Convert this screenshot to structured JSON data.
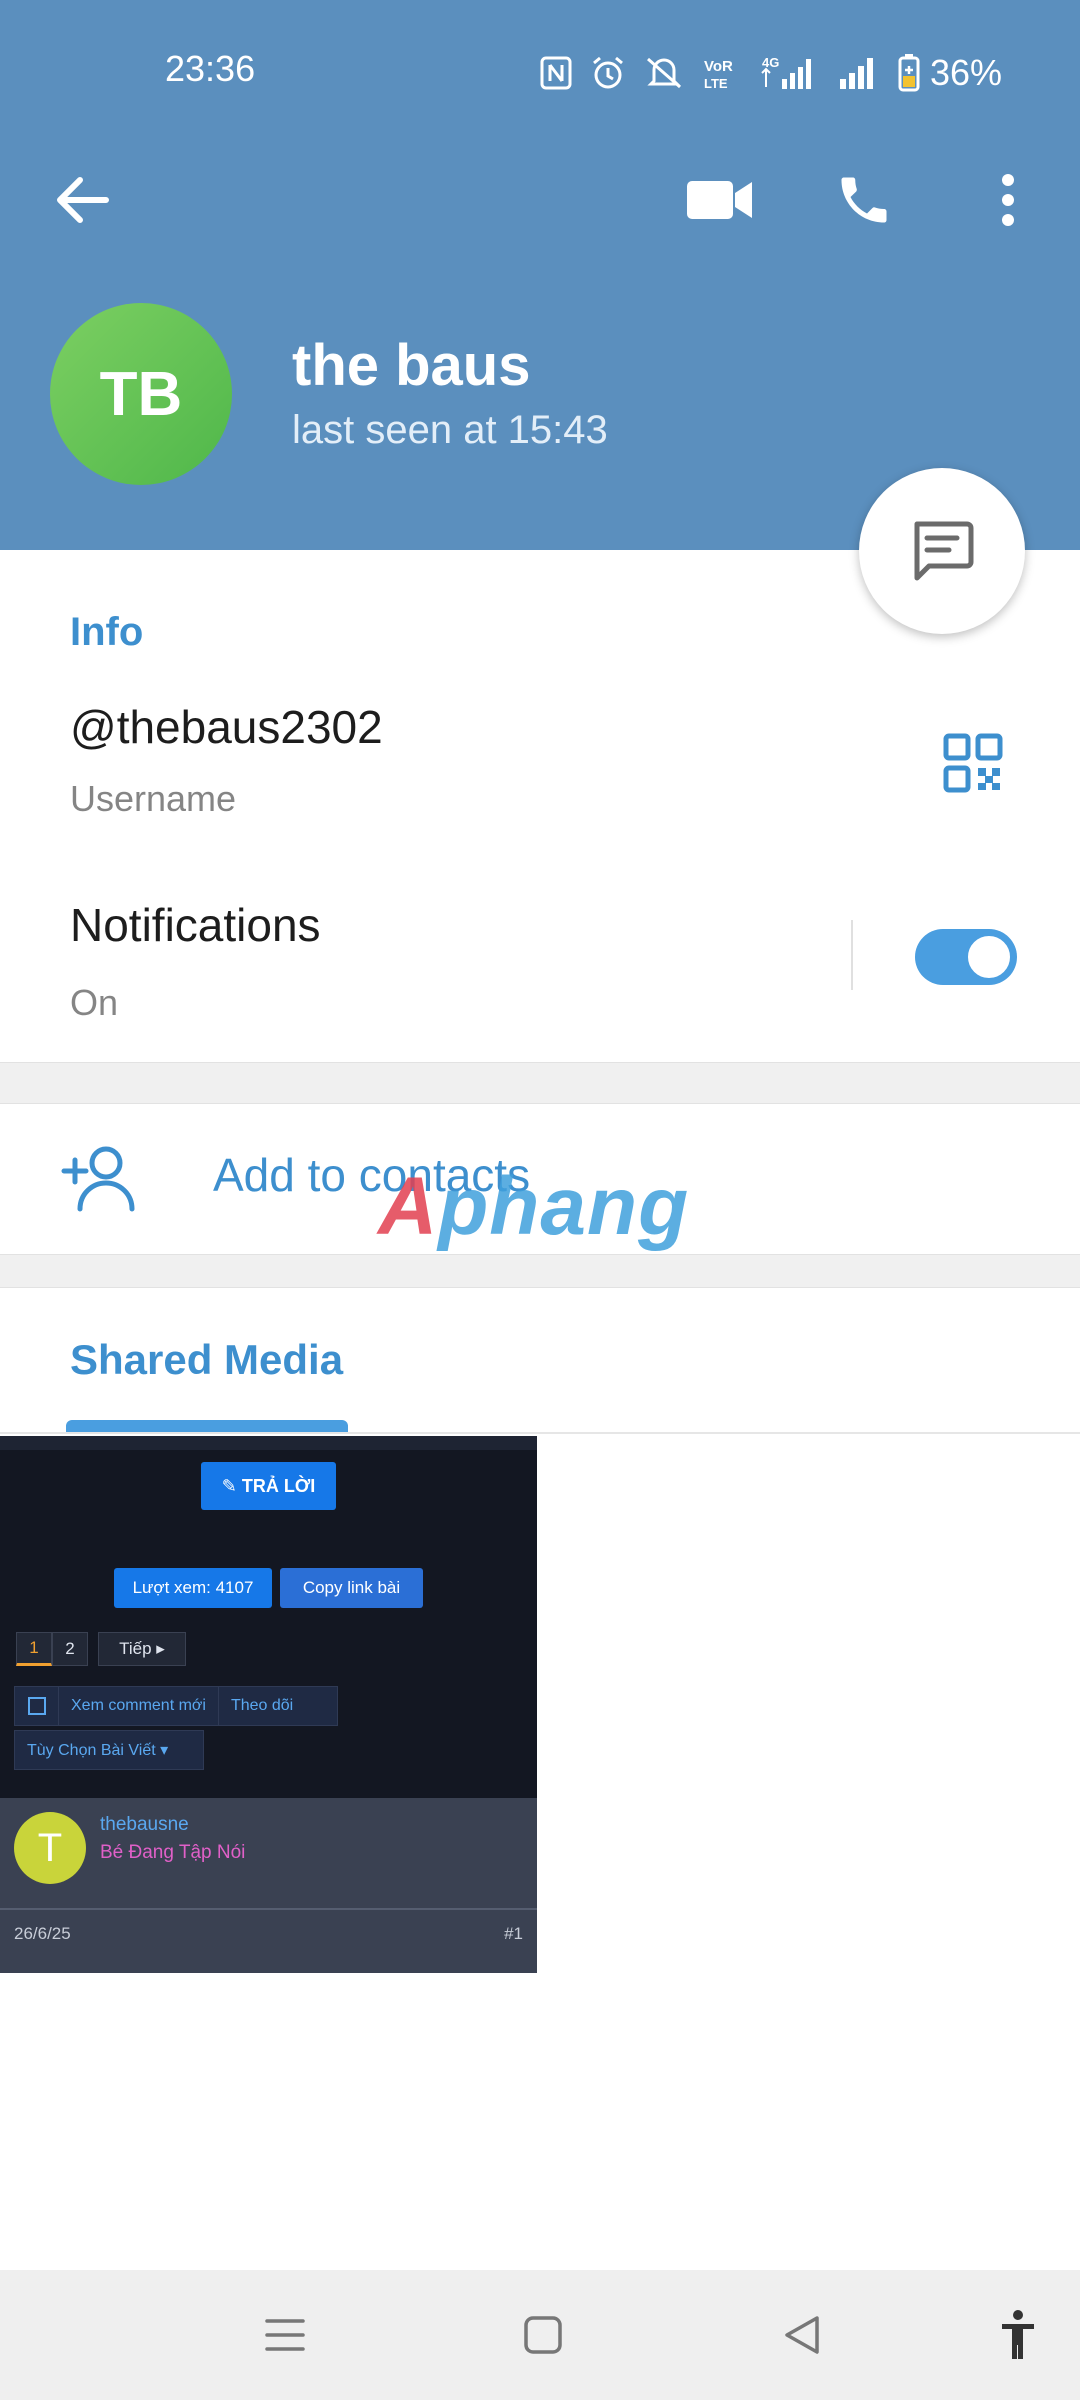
{
  "status_bar": {
    "time": "23:36",
    "battery_percent": "36%",
    "icons": [
      "nfc-icon",
      "alarm-icon",
      "mute-icon",
      "volte-icon",
      "4g-signal-icon",
      "signal-icon",
      "battery-icon"
    ]
  },
  "header": {
    "back_icon": "back-arrow-icon",
    "video_icon": "video-call-icon",
    "call_icon": "phone-icon",
    "more_icon": "more-vert-icon",
    "background_color": "#5b8fbe"
  },
  "profile": {
    "initials": "TB",
    "name": "the baus",
    "status": "last seen at 15:43",
    "avatar_color": "#5fc253"
  },
  "info": {
    "title": "Info",
    "username": "@thebaus2302",
    "username_label": "Username",
    "qr_icon": "qr-code-icon",
    "notifications_title": "Notifications",
    "notifications_value": "On",
    "notifications_enabled": true
  },
  "add_contacts": {
    "label": "Add to contacts",
    "icon": "add-person-icon"
  },
  "watermark": {
    "first": "A",
    "rest": "phang"
  },
  "shared_media": {
    "tab_label": "Shared Media",
    "thumbnail": {
      "reply_button": "✎ TRẢ LỜI",
      "views_button": "Lượt xem: 4107",
      "copy_button": "Copy link bài",
      "page_1": "1",
      "page_2": "2",
      "next_button": "Tiếp ▸",
      "new_comments": "Xem comment mới",
      "follow": "Theo dõi",
      "options": "Tùy Chọn Bài Viết ▾",
      "post_avatar_initial": "T",
      "post_user": "thebausne",
      "post_rank": "Bé Đang Tập Nói",
      "post_date": "26/6/25",
      "post_number": "#1"
    }
  },
  "accent_color": "#3d8fce",
  "nav_bar": {
    "icons": [
      "menu-icon",
      "home-square-icon",
      "back-triangle-icon",
      "accessibility-icon"
    ]
  }
}
